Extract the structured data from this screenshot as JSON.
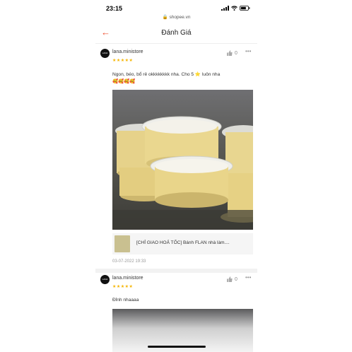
{
  "status": {
    "time": "23:15",
    "url": "shopee.vn"
  },
  "header": {
    "title": "Đánh Giá"
  },
  "reviews": [
    {
      "username": "lana.ministore",
      "stars": "★★★★★",
      "likes": "0",
      "text": "Ngon, béo, bổ rẻ okkkkkkkk nha. Cho 5 ⭐ luôn nha",
      "emojis": "🥰🥰🥰🥰",
      "product_name": "[CHỈ GIAO HOẢ TỐC] Bánh FLAN nhà làm....",
      "date": "03-07-2022 19:33"
    },
    {
      "username": "lana.ministore",
      "stars": "★★★★★",
      "likes": "0",
      "text": "Đỉnh nhaaaa"
    }
  ],
  "colors": {
    "accent": "#ee4d2d",
    "star": "#f5b400"
  }
}
